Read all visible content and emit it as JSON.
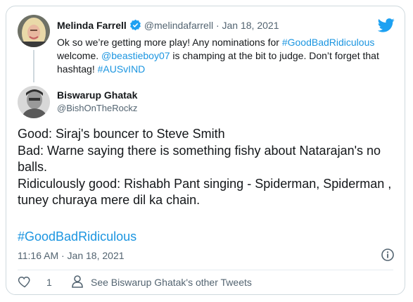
{
  "parent_tweet": {
    "author_name": "Melinda Farrell",
    "handle": "@melindafarrell",
    "separator": "·",
    "date": "Jan 18, 2021",
    "text_parts": {
      "intro": "Ok so we’re getting more play! Any nominations for ",
      "hashtag_1": "#GoodBadRidiculous",
      "mid_1": " welcome. ",
      "mention": "@beastieboy07",
      "mid_2": " is champing at the bit to judge. Don’t forget that hashtag! ",
      "hashtag_2": "#AUSvIND"
    }
  },
  "tweet": {
    "author_name": "Biswarup Ghatak",
    "handle": "@BishOnTheRockz",
    "lines": [
      "Good: Siraj's bouncer to Steve Smith",
      "Bad: Warne saying there is something fishy about Natarajan's no balls.",
      "Ridiculously good: Rishabh Pant singing - Spiderman, Spiderman , tuney churaya mere dil ka chain."
    ],
    "hashtag": "#GoodBadRidiculous",
    "timestamp": "11:16 AM · Jan 18, 2021"
  },
  "actions": {
    "like_count": "1",
    "other_tweets_label": "See Biswarup Ghatak's other Tweets"
  },
  "colors": {
    "brand_blue": "#1da1f2",
    "link_blue": "#1b95e0",
    "secondary_text": "#536471"
  },
  "icons": [
    "verified-badge-icon",
    "twitter-bird-icon",
    "info-icon",
    "heart-icon",
    "person-icon"
  ]
}
